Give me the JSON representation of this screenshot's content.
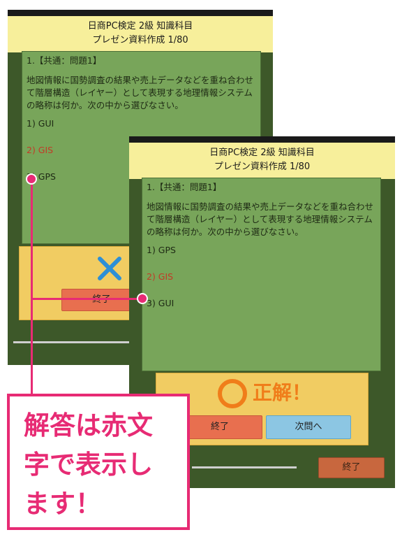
{
  "screen1": {
    "title_line1": "日商PC検定 2級 知識科目",
    "title_line2": "プレゼン資料作成 1/80",
    "question_header": "1.【共通：問題1】",
    "question_body": "地図情報に国勢調査の結果や売上データなどを重ね合わせて階層構造（レイヤー）として表現する地理情報システムの略称は何か。次の中から選びなさい。",
    "choices": [
      "1) GUI",
      "2) GIS",
      "3) GPS"
    ],
    "exit_label": "終了"
  },
  "screen2": {
    "title_line1": "日商PC検定 2級 知識科目",
    "title_line2": "プレゼン資料作成 1/80",
    "question_header": "1.【共通：問題1】",
    "question_body": "地図情報に国勢調査の結果や売上データなどを重ね合わせて階層構造（レイヤー）として表現する地理情報システムの略称は何か。次の中から選びなさい。",
    "choices": [
      "1) GPS",
      "2) GIS",
      "3) GUI"
    ],
    "result_text": "正解！",
    "exit_label": "終了",
    "next_label": "次問へ",
    "end_label": "終了"
  },
  "callout": {
    "line1": "解答は赤文",
    "line2": "字で表示し",
    "line3": "ます！"
  },
  "colors": {
    "title_bg": "#f7ef9b",
    "board_bg": "#3d5829",
    "panel_bg": "#78a55a",
    "answer_red": "#c33a26",
    "result_bg": "#f1cc62",
    "callout_pink": "#e72b74",
    "exit_button": "#e86f4f",
    "next_button": "#8cc6e3"
  },
  "icons": {
    "wrong": "cross-mark-icon",
    "correct": "circle-mark-icon"
  }
}
